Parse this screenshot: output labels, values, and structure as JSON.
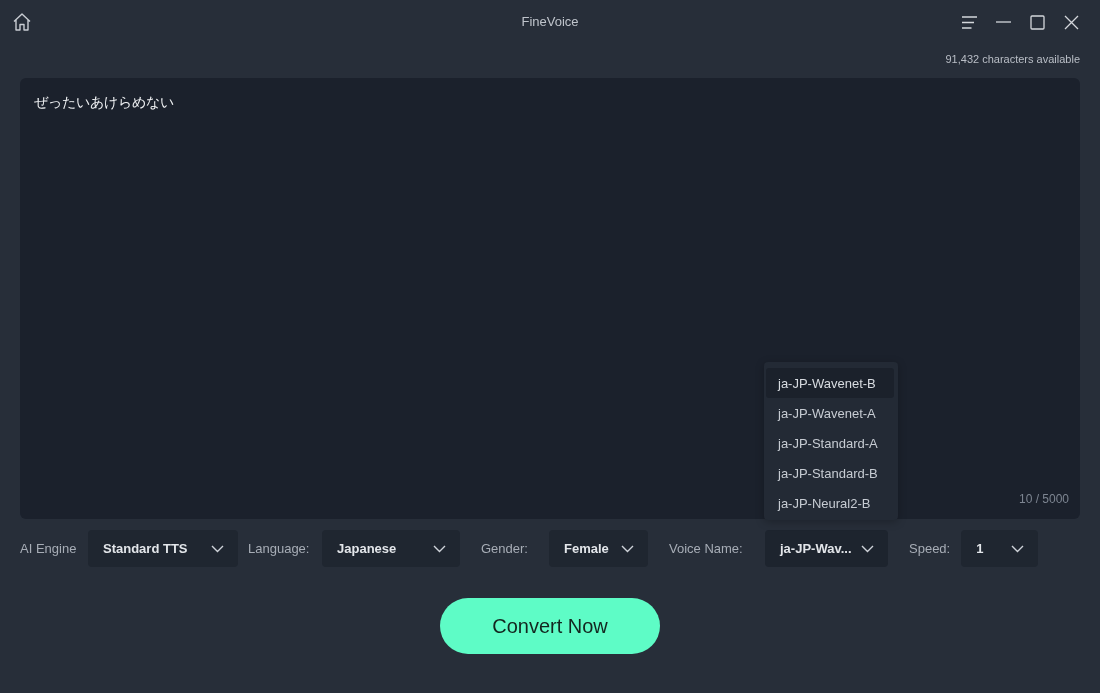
{
  "window": {
    "title": "FineVoice"
  },
  "credits": "91,432 characters available",
  "editor": {
    "value": "ぜったいあけらめない",
    "counter": "10 / 5000"
  },
  "controls": [
    {
      "label": "AI Engine",
      "value": "Standard TTS"
    },
    {
      "label": "Language:",
      "value": "Japanese"
    },
    {
      "label": "Gender:",
      "value": "Female"
    },
    {
      "label": "Voice Name:",
      "value": "ja-JP-Wav...",
      "expanded": true,
      "options": [
        {
          "label": "ja-JP-Wavenet-B",
          "selected": true
        },
        {
          "label": "ja-JP-Wavenet-A",
          "selected": false
        },
        {
          "label": "ja-JP-Standard-A",
          "selected": false
        },
        {
          "label": "ja-JP-Standard-B",
          "selected": false
        },
        {
          "label": "ja-JP-Neural2-B",
          "selected": false
        }
      ]
    },
    {
      "label": "Speed:",
      "value": "1"
    }
  ],
  "convert_button": "Convert Now"
}
